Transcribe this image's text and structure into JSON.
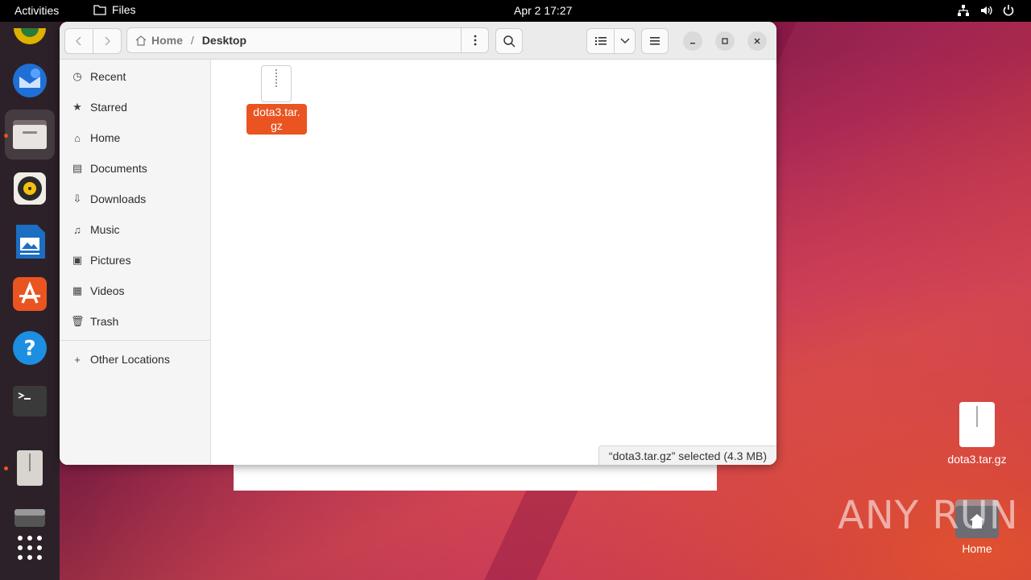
{
  "topbar": {
    "activities": "Activities",
    "app_name": "Files",
    "clock": "Apr 2  17:27"
  },
  "dock": {
    "items": [
      "chrome-icon",
      "thunderbird-icon",
      "files-icon",
      "rhythmbox-icon",
      "writer-icon",
      "app-center-icon",
      "help-icon",
      "terminal-icon",
      "archive-icon",
      "drive-icon",
      "app-grid-icon"
    ]
  },
  "window": {
    "path": {
      "home": "Home",
      "separator": "/",
      "current": "Desktop"
    },
    "sidebar": {
      "items": [
        {
          "label": "Recent",
          "icon": "clock-icon"
        },
        {
          "label": "Starred",
          "icon": "star-icon"
        },
        {
          "label": "Home",
          "icon": "home-icon"
        },
        {
          "label": "Documents",
          "icon": "document-icon"
        },
        {
          "label": "Downloads",
          "icon": "download-icon"
        },
        {
          "label": "Music",
          "icon": "music-icon"
        },
        {
          "label": "Pictures",
          "icon": "picture-icon"
        },
        {
          "label": "Videos",
          "icon": "video-icon"
        },
        {
          "label": "Trash",
          "icon": "trash-icon"
        }
      ],
      "other": "Other Locations"
    },
    "file": {
      "name_line1": "dota3.tar.",
      "name_line2": "gz"
    },
    "status": "“dota3.tar.gz” selected  (4.3 MB)"
  },
  "desktop": {
    "file_label": "dota3.tar.gz",
    "home_label": "Home",
    "watermark": "ANY RUN"
  },
  "colors": {
    "accent": "#e95420",
    "topbar": "#000000",
    "dock": "#2c2128"
  }
}
